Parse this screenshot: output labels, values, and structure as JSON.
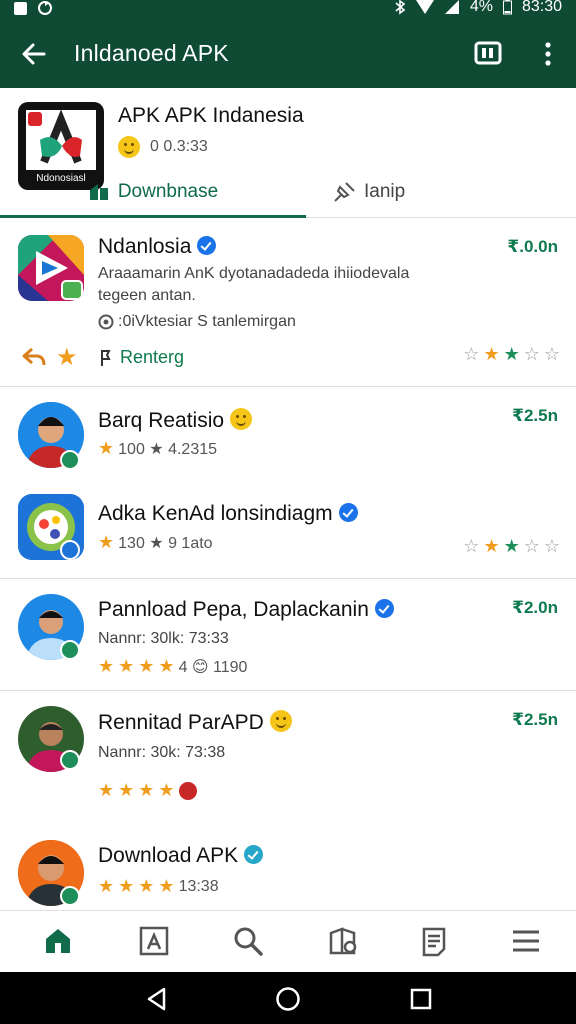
{
  "status_bar": {
    "battery": "4%",
    "time": "83:30"
  },
  "app_bar": {
    "title": "Inldanoed APK"
  },
  "header": {
    "app_name": "APK APK Indanesia",
    "meta_text": "0 0.3:33",
    "logo_caption": "Ndonosiasl",
    "tabs": [
      {
        "label": "Downbnase",
        "active": true
      },
      {
        "label": "Ianip",
        "active": false
      }
    ]
  },
  "rows": [
    {
      "title": "Ndanlosia",
      "price": "₹.0.0n",
      "desc_line1": "Araaamarin AnK dyotanadadeda ihiiodevala",
      "desc_line2": "tegeen antan.",
      "meta_line": ":0iVktesiar S tanlemirgan",
      "action_label": "Renterg",
      "rating": 2.5
    },
    {
      "title": "Barq Reatisio",
      "price": "₹2.5n",
      "meta": "100 ★ 4.2315"
    },
    {
      "title": "Adka KenAd lonsindiagm",
      "meta": "130 ★ 9 1ato",
      "rating": 2.5
    },
    {
      "title": "Pannload Pepa, Daplackanin",
      "price": "₹2.0n",
      "sub": "Nannr: 30lk: 73:33",
      "meta": "4 😊 1190"
    },
    {
      "title": "Rennitad ParAPD",
      "price": "₹2.5n",
      "sub": "Nannr: 30k: 73:38"
    },
    {
      "title": "Download APK",
      "meta": "13:38"
    }
  ],
  "colors": {
    "primary": "#0f4a35",
    "accent": "#0f6b4a",
    "price": "#0f7a4f",
    "star": "#f09d1e",
    "verify": "#1a73e8"
  }
}
